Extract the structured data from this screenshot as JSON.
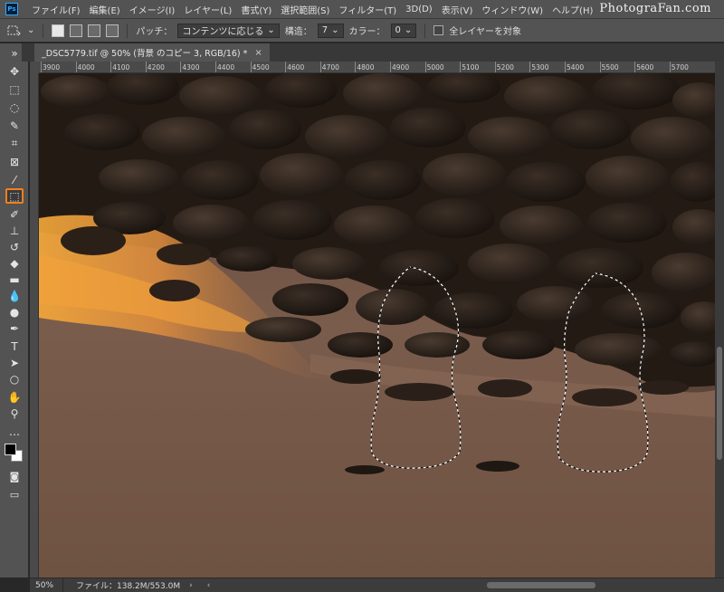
{
  "app": {
    "logo_text": "Ps"
  },
  "menu": [
    "ファイル(F)",
    "編集(E)",
    "イメージ(I)",
    "レイヤー(L)",
    "書式(Y)",
    "選択範囲(S)",
    "フィルター(T)",
    "3D(D)",
    "表示(V)",
    "ウィンドウ(W)",
    "ヘルプ(H)"
  ],
  "watermark": "PhotograFan.com",
  "options": {
    "patch_label": "パッチ：",
    "patch_value": "コンテンツに応じる",
    "structure_label": "構造：",
    "structure_value": "7",
    "color_label": "カラー：",
    "color_value": "0",
    "all_layers_label": "全レイヤーを対象"
  },
  "document_tab": {
    "title": "_DSC5779.tif @ 50% (背景 のコピー 3, RGB/16) *",
    "close": "×"
  },
  "ruler": {
    "top_ticks": [
      "3900",
      "4000",
      "4100",
      "4200",
      "4300",
      "4400",
      "4500",
      "4600",
      "4700",
      "4800",
      "4900",
      "5000",
      "5100",
      "5200",
      "5300",
      "5400",
      "5500",
      "5600",
      "5700"
    ]
  },
  "tools": [
    {
      "name": "move-tool",
      "glyph": "✥"
    },
    {
      "name": "marquee-tool",
      "glyph": "⬚"
    },
    {
      "name": "lasso-tool",
      "glyph": "◌"
    },
    {
      "name": "quick-select-tool",
      "glyph": "✎"
    },
    {
      "name": "crop-tool",
      "glyph": "⌗"
    },
    {
      "name": "frame-tool",
      "glyph": "⊠"
    },
    {
      "name": "eyedropper-tool",
      "glyph": "⁄"
    },
    {
      "name": "patch-tool",
      "glyph": "⬚"
    },
    {
      "name": "brush-tool",
      "glyph": "✐"
    },
    {
      "name": "stamp-tool",
      "glyph": "⊥"
    },
    {
      "name": "history-brush-tool",
      "glyph": "↺"
    },
    {
      "name": "eraser-tool",
      "glyph": "◆"
    },
    {
      "name": "gradient-tool",
      "glyph": "▬"
    },
    {
      "name": "blur-tool",
      "glyph": "💧"
    },
    {
      "name": "dodge-tool",
      "glyph": "●"
    },
    {
      "name": "pen-tool",
      "glyph": "✒"
    },
    {
      "name": "type-tool",
      "glyph": "T"
    },
    {
      "name": "path-select-tool",
      "glyph": "➤"
    },
    {
      "name": "shape-tool",
      "glyph": "○"
    },
    {
      "name": "hand-tool",
      "glyph": "✋"
    },
    {
      "name": "zoom-tool",
      "glyph": "⚲"
    },
    {
      "name": "more-tools",
      "glyph": "…"
    }
  ],
  "status": {
    "zoom": "50%",
    "file_info": "ファイル：138.2M/553.0M",
    "arrow": "›",
    "scroll_left": "‹"
  },
  "colors": {
    "foreground": "#000000",
    "background": "#ffffff",
    "active_tool_border": "#f47e20"
  }
}
